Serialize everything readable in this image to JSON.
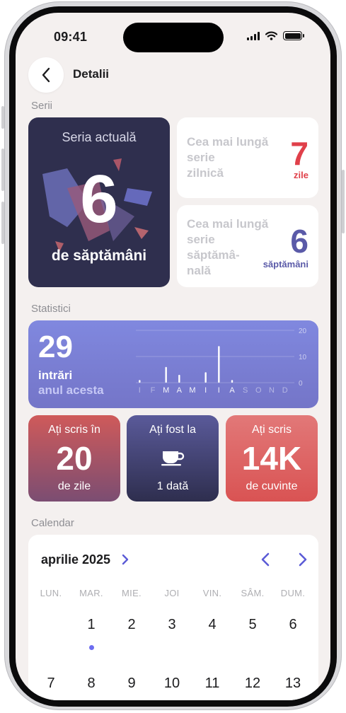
{
  "status_bar": {
    "time": "09:41"
  },
  "header": {
    "title": "Detalii"
  },
  "sections": {
    "streaks": "Serii",
    "stats": "Statistici",
    "calendar": "Calendar"
  },
  "streaks": {
    "current": {
      "label": "Seria actuală",
      "value": "6",
      "unit": "de săptămâni"
    },
    "longest_daily": {
      "line1": "Cea mai lungă",
      "line2": "serie",
      "line3": "zilnică",
      "value": "7",
      "unit": "zile",
      "color": "#e0404a"
    },
    "longest_weekly": {
      "line1": "Cea mai lungă",
      "line2": "serie",
      "line3": "săptămâ-",
      "line4": "nală",
      "value": "6",
      "unit": "săptămâni",
      "color": "#5a5aa8"
    }
  },
  "stats": {
    "entries": {
      "value": "29",
      "label1": "intrări",
      "label2": "anul acesta"
    },
    "days_written": {
      "top": "Ați scris în",
      "value": "20",
      "bottom": "de zile"
    },
    "visits": {
      "top": "Ați fost la",
      "icon": "coffee-cup-icon",
      "bottom": "1 dată"
    },
    "words": {
      "top": "Ați scris",
      "value": "14K",
      "bottom": "de cuvinte"
    }
  },
  "chart_data": {
    "type": "bar",
    "categories": [
      "I",
      "F",
      "M",
      "A",
      "M",
      "I",
      "I",
      "A",
      "S",
      "O",
      "N",
      "D"
    ],
    "values": [
      1,
      0,
      6,
      3,
      0,
      4,
      14,
      1,
      0,
      0,
      0,
      0
    ],
    "highlighted_months": [
      2,
      3,
      4,
      5,
      6,
      7
    ],
    "yticks": [
      "0",
      "10",
      "20"
    ],
    "ylim": [
      0,
      20
    ],
    "grid": true
  },
  "calendar": {
    "month": "aprilie 2025",
    "weekdays": [
      "LUN.",
      "MAR.",
      "MIE.",
      "JOI",
      "VIN.",
      "SÂM.",
      "DUM."
    ],
    "week1": [
      "",
      "1",
      "2",
      "3",
      "4",
      "5",
      "6"
    ],
    "week2": [
      "7",
      "8",
      "9",
      "10",
      "11",
      "12",
      "13"
    ],
    "marked_day": "1",
    "accent": "#5b5bd6"
  }
}
